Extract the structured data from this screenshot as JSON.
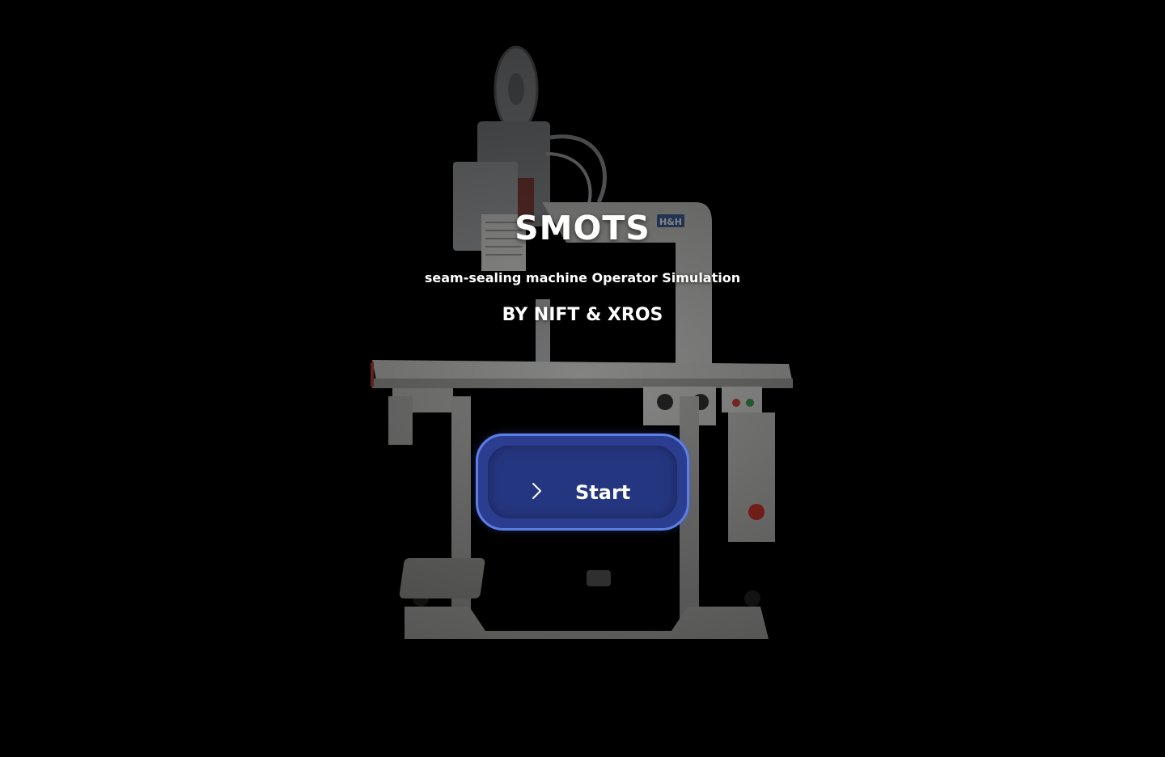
{
  "hero": {
    "title": "SMOTS",
    "subtitle": "seam-sealing machine Operator Simulation",
    "credit": "BY NIFT & XROS",
    "machine_badge": "H&H"
  },
  "start_button": {
    "label": "Start",
    "icon": "chevron-right-icon"
  },
  "colors": {
    "background": "#000000",
    "button_fill": "#2a3d8f",
    "button_border": "#5d7ee6",
    "text": "#ffffff"
  }
}
